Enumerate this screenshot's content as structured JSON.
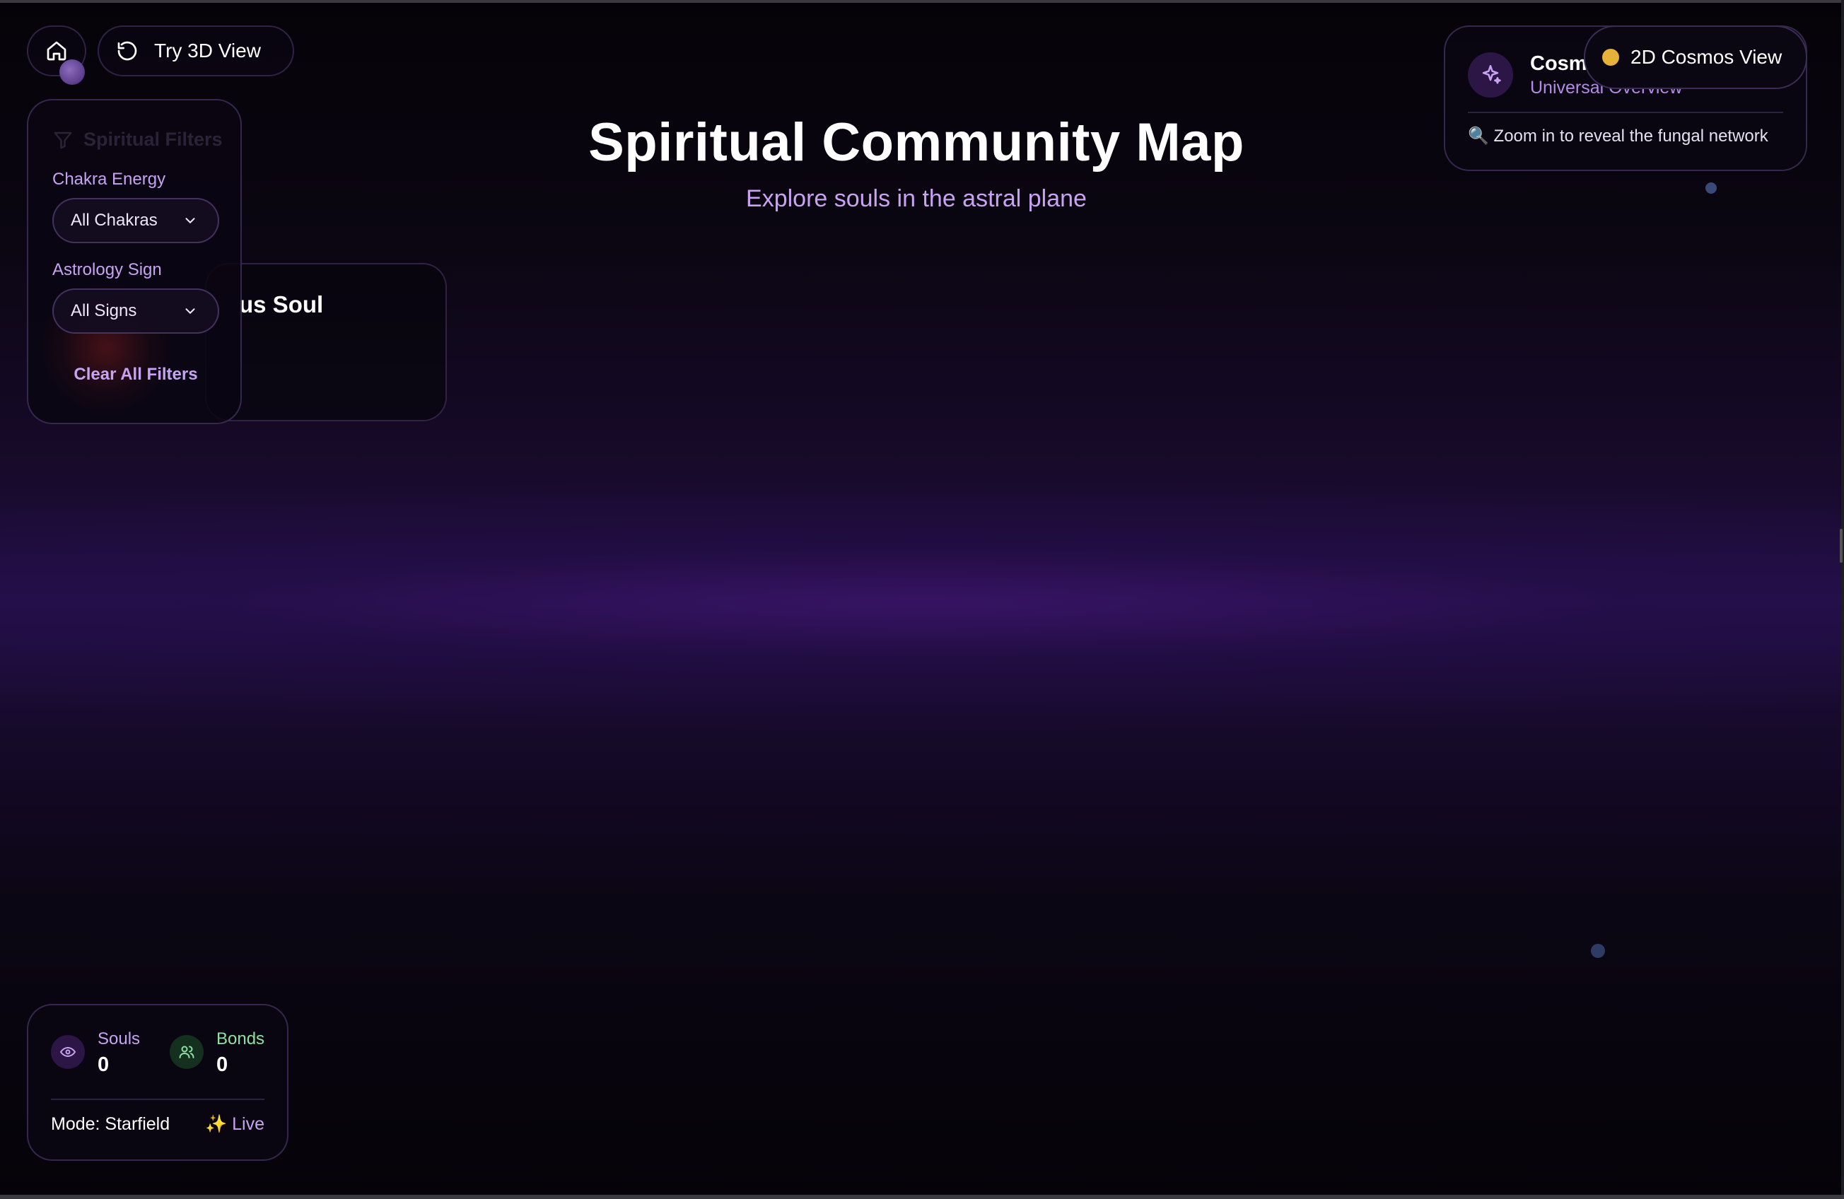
{
  "nav": {
    "home_icon": "home-icon",
    "try3d_icon": "refresh-icon",
    "try3d_label": "Try 3D View"
  },
  "header": {
    "title": "Spiritual Community Map",
    "subtitle": "Explore souls in the astral plane"
  },
  "soul_card": {
    "name_partial": "us Soul"
  },
  "filters": {
    "header_icon": "filter-icon",
    "header_label": "Spiritual Filters",
    "chakra_label": "Chakra Energy",
    "chakra_value": "All Chakras",
    "astrology_label": "Astrology Sign",
    "astrology_value": "All Signs",
    "clear_label": "Clear All Filters"
  },
  "cosmos": {
    "icon": "sparkles-icon",
    "title_partial": "Cosm",
    "subtitle": "Universal Overview",
    "hint": "🔍 Zoom in to reveal the fungal network"
  },
  "view_toggle": {
    "label": "2D Cosmos View",
    "dot_color": "#e6b23a"
  },
  "stats": {
    "souls_label": "Souls",
    "souls_value": "0",
    "bonds_label": "Bonds",
    "bonds_value": "0",
    "mode": "Mode: Starfield",
    "live": "✨ Live"
  },
  "colors": {
    "accent_purple": "#c7a3f2",
    "background": "#050308",
    "bonds_green": "#8fe0a2"
  }
}
